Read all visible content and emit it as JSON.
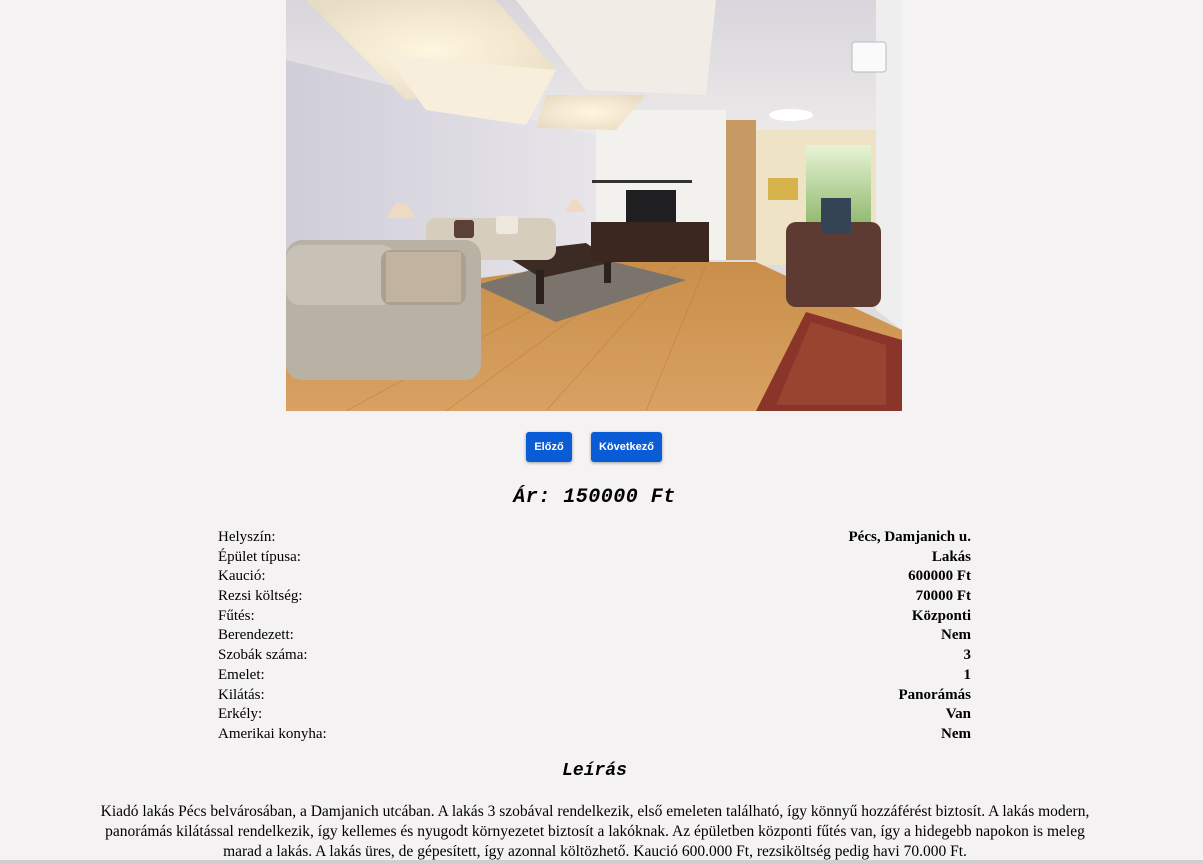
{
  "listing": {
    "photo_icon": "living-room-photo",
    "prev_label": "Előző",
    "next_label": "Következő",
    "price_text": "Ár: 150000 Ft"
  },
  "details": [
    {
      "label": "Helyszín:",
      "value": "Pécs, Damjanich u."
    },
    {
      "label": "Épület típusa:",
      "value": "Lakás"
    },
    {
      "label": "Kaució:",
      "value": "600000 Ft"
    },
    {
      "label": "Rezsi költség:",
      "value": "70000 Ft"
    },
    {
      "label": "Fűtés:",
      "value": "Központi"
    },
    {
      "label": "Berendezett:",
      "value": "Nem"
    },
    {
      "label": "Szobák száma:",
      "value": "3"
    },
    {
      "label": "Emelet:",
      "value": "1"
    },
    {
      "label": "Kilátás:",
      "value": "Panorámás"
    },
    {
      "label": "Erkély:",
      "value": "Van"
    },
    {
      "label": "Amerikai konyha:",
      "value": "Nem"
    }
  ],
  "description": {
    "title": "Leírás",
    "text": "Kiadó lakás Pécs belvárosában, a Damjanich utcában. A lakás 3 szobával rendelkezik, első emeleten található, így könnyű hozzáférést biztosít. A lakás modern, panorámás kilátással rendelkezik, így kellemes és nyugodt környezetet biztosít a lakóknak. Az épületben központi fűtés van, így a hidegebb napokon is meleg marad a lakás. A lakás üres, de gépesített, így azonnal költözhető. Kaució 600.000 Ft, rezsiköltség pedig havi 70.000 Ft."
  },
  "colors": {
    "background": "#f4f2f3",
    "button": "#0a5bd6",
    "button_text": "#ffffff"
  }
}
